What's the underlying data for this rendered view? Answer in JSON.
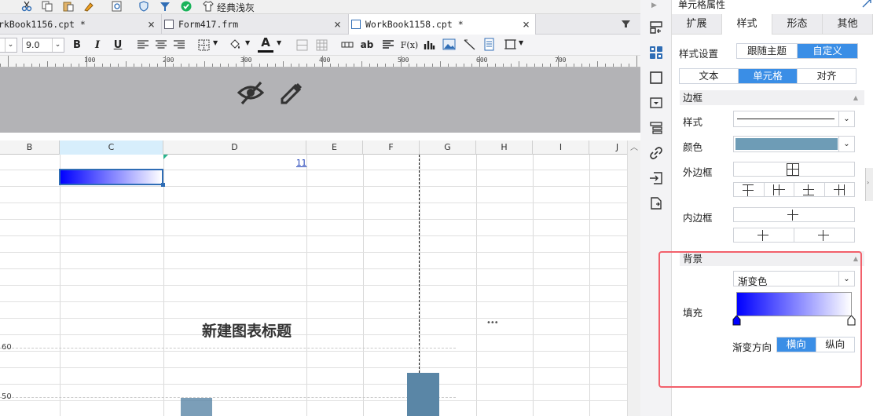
{
  "toolbar": {
    "style_label": "经典浅灰"
  },
  "tabs": [
    {
      "label": "rkBook1156.cpt *",
      "active": false
    },
    {
      "label": "Form417.frm",
      "active": false
    },
    {
      "label": "WorkBook1158.cpt *",
      "active": true
    }
  ],
  "format": {
    "font_size_value": "9.0",
    "bold_label": "B",
    "italic_label": "I",
    "underline_label": "U",
    "font_color_label": "A",
    "text_label": "ab",
    "formula_label": "F(x)"
  },
  "ruler": {
    "labels": [
      "100",
      "200",
      "300",
      "400",
      "500",
      "600",
      "700"
    ]
  },
  "columns": [
    "B",
    "C",
    "D",
    "E",
    "F",
    "G",
    "H",
    "I",
    "J"
  ],
  "sheet": {
    "d_value": "11",
    "chart_title": "新建图表标题",
    "more_label": "•••",
    "axis_60": "60",
    "axis_50": "50"
  },
  "panel": {
    "title": "单元格属性",
    "tabs": [
      "扩展",
      "样式",
      "形态",
      "其他"
    ],
    "active_tab": "样式",
    "style_setting_label": "样式设置",
    "style_options": [
      "跟随主题",
      "自定义"
    ],
    "style_active": "自定义",
    "subtabs": [
      "文本",
      "单元格",
      "对齐"
    ],
    "subtab_active": "单元格",
    "border": {
      "section": "边框",
      "style_label": "样式",
      "color_label": "颜色",
      "outer_label": "外边框",
      "inner_label": "内边框",
      "color_value": "#6e9cb6"
    },
    "background": {
      "section": "背景",
      "fill_type": "渐变色",
      "fill_label": "填充",
      "direction_label": "渐变方向",
      "direction_options": [
        "横向",
        "纵向"
      ],
      "direction_active": "横向",
      "gradient_start": "#0000ff",
      "gradient_end": "#ffffff"
    }
  },
  "colors": {
    "accent": "#3a8ee6",
    "bar": "#5a86a6",
    "highlight": "#f2606b"
  }
}
